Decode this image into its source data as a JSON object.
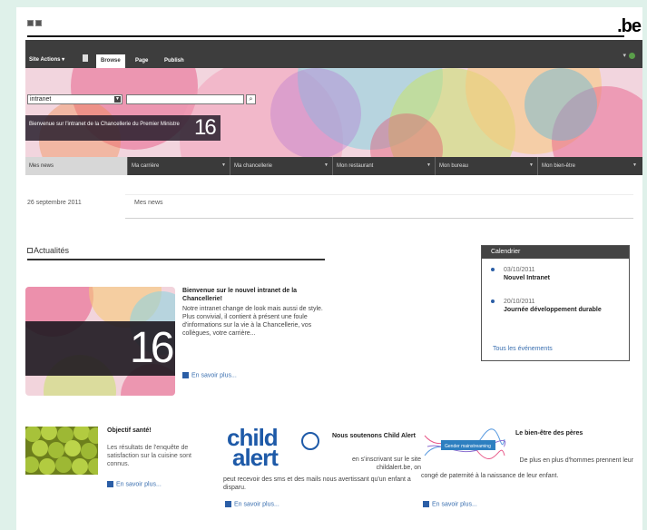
{
  "header": {
    "logo": ".be"
  },
  "ribbon": {
    "site_actions": "Site Actions",
    "tabs": [
      {
        "label": "Browse"
      },
      {
        "label": "Page"
      },
      {
        "label": "Publish"
      }
    ]
  },
  "banner": {
    "site_selector_value": "intranet",
    "welcome_text": "Bienvenue sur l'intranet de la Chancellerie du Premier Ministre",
    "number": "16"
  },
  "nav": {
    "items": [
      {
        "label": "Mes news"
      },
      {
        "label": "Ma carrière"
      },
      {
        "label": "Ma chancellerie"
      },
      {
        "label": "Mon restaurant"
      },
      {
        "label": "Mon bureau"
      },
      {
        "label": "Mon bien-être"
      }
    ]
  },
  "date_row": {
    "date": "26 septembre 2011",
    "section": "Mes news"
  },
  "actualites": {
    "heading": "Actualités"
  },
  "feature": {
    "number": "16",
    "title": "Bienvenue sur le nouvel intranet de la Chancellerie!",
    "body": "Notre intranet change de look mais aussi de style. Plus convivial, il contient à présent une foule d'informations sur la vie à la Chancellerie, vos collègues, votre carrière...",
    "more": "En savoir plus..."
  },
  "calendar": {
    "title": "Calendrier",
    "events": [
      {
        "date": "03/10/2011",
        "title": "Nouvel Intranet"
      },
      {
        "date": "20/10/2011",
        "title": "Journée développement durable"
      }
    ],
    "all_events": "Tous les événements"
  },
  "cards": {
    "sante": {
      "title": "Objectif santé!",
      "body": "Les résultats de l'enquête de satisfaction sur la cuisine sont connus.",
      "more": "En savoir plus..."
    },
    "child": {
      "logo_line1": "child",
      "logo_line2": "alert",
      "title": "Nous soutenons Child Alert",
      "body": "en s'inscrivant sur le site childalert.be, on",
      "body2": "peut recevoir des sms et des mails nous avertissant qu'un enfant a disparu.",
      "more": "En savoir plus..."
    },
    "bienetre": {
      "logo_text": "Gender mainstreaming",
      "title": "Le bien-être des pères",
      "body": "De plus en plus d'hommes prennent leur",
      "body2": "congé de paternité à la naissance de leur enfant.",
      "more": "En savoir plus..."
    }
  }
}
